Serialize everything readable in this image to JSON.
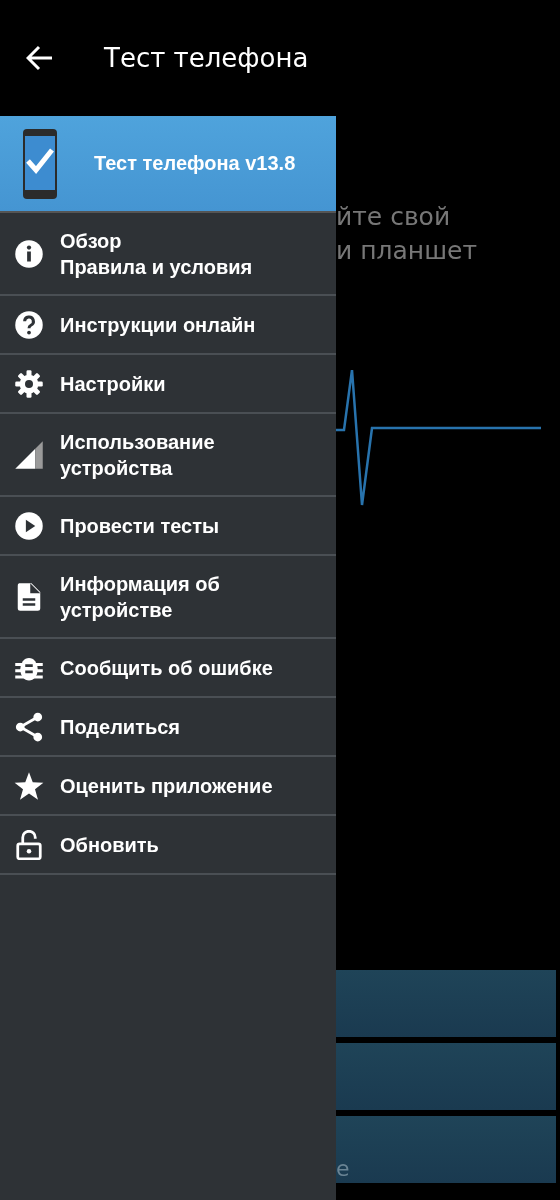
{
  "app_bar": {
    "title": "Тест телефона"
  },
  "drawer": {
    "header": {
      "title": "Тест телефона v13.8"
    },
    "items": [
      {
        "label": "Обзор\nПравила и условия"
      },
      {
        "label": "Инструкции онлайн"
      },
      {
        "label": "Настройки"
      },
      {
        "label": "Использование\nустройства"
      },
      {
        "label": "Провести тесты"
      },
      {
        "label": "Информация об\nустройстве"
      },
      {
        "label": "Сообщить об ошибке"
      },
      {
        "label": "Поделиться"
      },
      {
        "label": "Оценить приложение"
      },
      {
        "label": "Обновить"
      }
    ]
  },
  "background": {
    "text_lines": [
      "йте свой",
      "и планшет"
    ],
    "buttons": [
      {
        "kind": "button"
      },
      {
        "kind": "button"
      },
      {
        "kind": "button",
        "label": "e"
      }
    ]
  }
}
